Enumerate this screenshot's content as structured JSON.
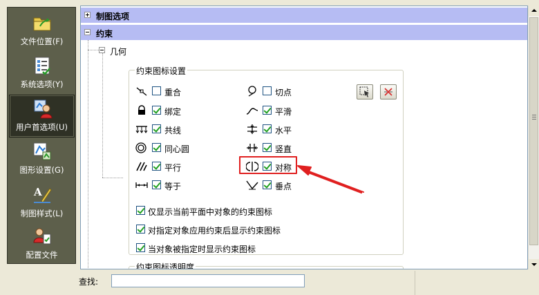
{
  "sidebar": {
    "items": [
      {
        "label": "文件位置(F)",
        "icon": "folder-icon",
        "active": false
      },
      {
        "label": "系统选项(Y)",
        "icon": "checklist-icon",
        "active": false
      },
      {
        "label": "用户首选项(U)",
        "icon": "user-preferences-icon",
        "active": true
      },
      {
        "label": "图形设置(G)",
        "icon": "graphics-settings-icon",
        "active": false
      },
      {
        "label": "制图样式(L)",
        "icon": "drafting-style-icon",
        "active": false
      },
      {
        "label": "配置文件",
        "icon": "profile-icon",
        "active": false
      }
    ]
  },
  "tree": {
    "drawing_options": "制图选项",
    "constraints": "约束",
    "geometry": "几何"
  },
  "constraint_icons": {
    "group_title": "约束图标设置",
    "items": [
      {
        "label": "重合",
        "checked": false,
        "icon": "coincident-icon"
      },
      {
        "label": "切点",
        "checked": false,
        "icon": "tangent-icon"
      },
      {
        "label": "绑定",
        "checked": true,
        "icon": "lock-icon"
      },
      {
        "label": "平滑",
        "checked": true,
        "icon": "smooth-icon"
      },
      {
        "label": "共线",
        "checked": true,
        "icon": "collinear-icon"
      },
      {
        "label": "水平",
        "checked": true,
        "icon": "horizontal-icon"
      },
      {
        "label": "同心圆",
        "checked": true,
        "icon": "concentric-icon"
      },
      {
        "label": "竖直",
        "checked": true,
        "icon": "vertical-icon"
      },
      {
        "label": "平行",
        "checked": true,
        "icon": "parallel-icon"
      },
      {
        "label": "对称",
        "checked": true,
        "icon": "symmetric-icon"
      },
      {
        "label": "等于",
        "checked": true,
        "icon": "equal-icon"
      },
      {
        "label": "垂点",
        "checked": true,
        "icon": "perpendicular-icon"
      }
    ],
    "options": [
      {
        "label": "仅显示当前平面中对象的约束图标",
        "checked": true
      },
      {
        "label": "对指定对象应用约束后显示约束图标",
        "checked": true
      },
      {
        "label": "当对象被指定时显示约束图标",
        "checked": true
      }
    ],
    "select_all_icon": "select-all-icon",
    "clear_all_icon": "clear-all-icon"
  },
  "transparency": {
    "group_title": "约束图标透明度"
  },
  "search": {
    "label": "查找:",
    "value": ""
  },
  "colors": {
    "sidebar_bg": "#5d5f4b",
    "header_bg": "#b6bcf3",
    "highlight": "#e02020"
  }
}
